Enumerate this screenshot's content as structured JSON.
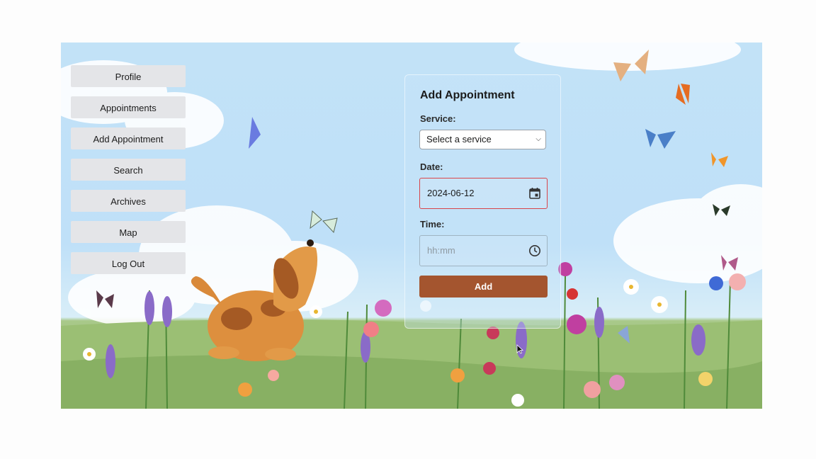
{
  "sidebar": {
    "items": [
      {
        "label": "Profile"
      },
      {
        "label": "Appointments"
      },
      {
        "label": "Add Appointment"
      },
      {
        "label": "Search"
      },
      {
        "label": "Archives"
      },
      {
        "label": "Map"
      },
      {
        "label": "Log Out"
      }
    ]
  },
  "form": {
    "title": "Add Appointment",
    "service_label": "Service:",
    "service_value": "Select a service",
    "date_label": "Date:",
    "date_value": "2024-06-12",
    "time_label": "Time:",
    "time_placeholder": "hh:mm",
    "add_label": "Add"
  },
  "icons": {
    "date": "calendar-icon",
    "time": "clock-icon",
    "dropdown": "chevron-down-icon"
  },
  "colors": {
    "accent": "#a4552f",
    "invalid_border": "#d9444a",
    "sky": "#c2e2f7",
    "nav_button": "#e4e5e8"
  }
}
